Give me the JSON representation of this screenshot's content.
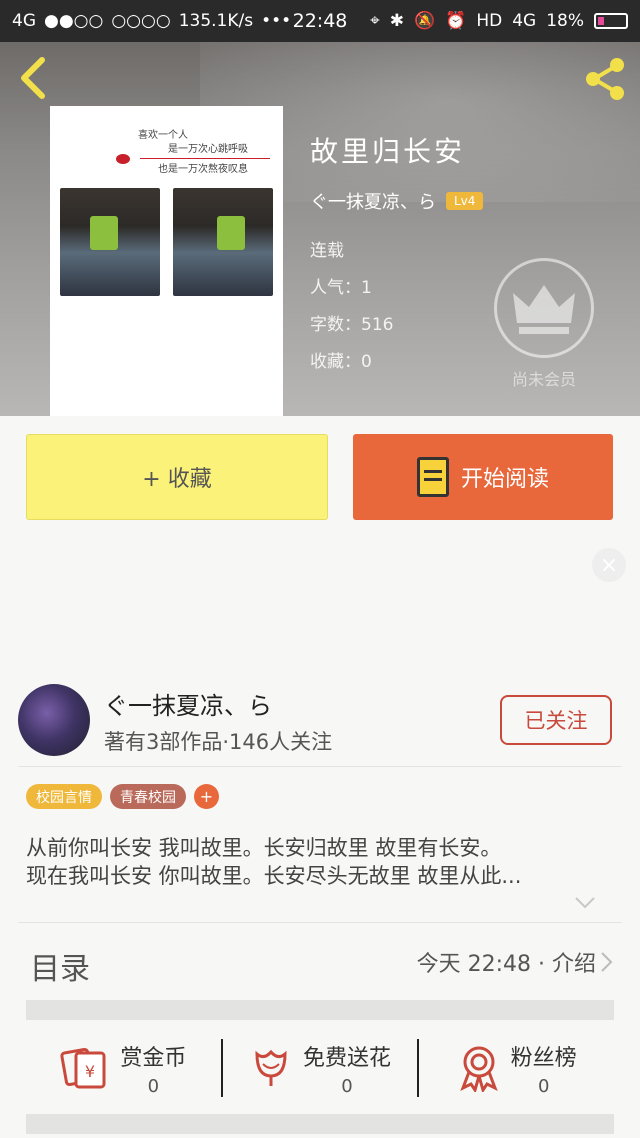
{
  "status_bar": {
    "network": "4G",
    "signal": "●●○○",
    "signal2": "○○○○",
    "speed": "135.1K/s",
    "dots": "•••",
    "time": "22:48",
    "hd": "HD",
    "net_right": "4G",
    "battery_pct": "18%"
  },
  "book": {
    "title": "故里归长安",
    "author": "ぐ一抹夏凉、ら",
    "level": "Lv4",
    "status": "连载",
    "popularity": "人气：1",
    "word_count": "字数：516",
    "favorites": "收藏：0"
  },
  "cover": {
    "line1": "喜欢一个人",
    "line2": "是一万次心跳呼吸",
    "line3": "也是一万次熬夜叹息"
  },
  "vip": {
    "label": "尚未会员"
  },
  "actions": {
    "favorite_label": "+ 收藏",
    "read_label": "开始阅读",
    "close_ad": "×"
  },
  "author_block": {
    "name": "ぐ一抹夏凉、ら",
    "stats": "著有3部作品·146人关注",
    "follow_label": "已关注"
  },
  "tags": {
    "items": [
      "校园言情",
      "青春校园"
    ],
    "add": "+"
  },
  "summary": {
    "line1": "从前你叫长安 我叫故里。长安归故里 故里有长安。",
    "line2": "现在我叫长安 你叫故里。长安尽头无故里 故里从此..."
  },
  "toc": {
    "title": "目录",
    "meta": "今天 22:48 · 介绍"
  },
  "stats": {
    "reward_label": "赏金币",
    "reward_value": "0",
    "flower_label": "免费送花",
    "flower_value": "0",
    "fans_label": "粉丝榜",
    "fans_value": "0"
  },
  "colors": {
    "accent_orange": "#e8683b",
    "accent_yellow": "#fbf27a",
    "badge_gold": "#f0b83a",
    "follow_red": "#c94a3c",
    "tag1": "#f0b83a",
    "tag2": "#b96a5a"
  }
}
